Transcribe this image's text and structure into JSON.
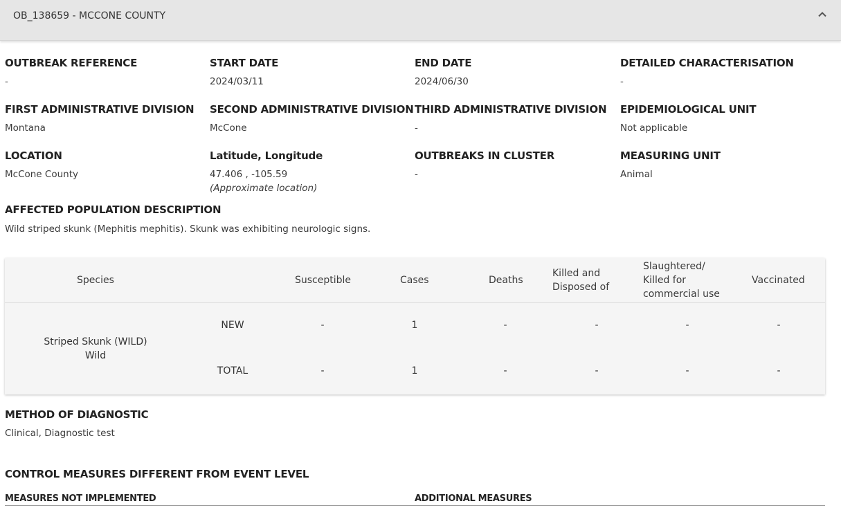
{
  "header": {
    "title": "OB_138659 - MCCONE COUNTY"
  },
  "fields": {
    "outbreak_reference": {
      "label": "OUTBREAK REFERENCE",
      "value": "-"
    },
    "start_date": {
      "label": "START DATE",
      "value": "2024/03/11"
    },
    "end_date": {
      "label": "END DATE",
      "value": "2024/06/30"
    },
    "detailed_characterisation": {
      "label": "DETAILED CHARACTERISATION",
      "value": "-"
    },
    "first_admin_division": {
      "label": "FIRST ADMINISTRATIVE DIVISION",
      "value": "Montana"
    },
    "second_admin_division": {
      "label": "SECOND ADMINISTRATIVE DIVISION",
      "value": "McCone"
    },
    "third_admin_division": {
      "label": "THIRD ADMINISTRATIVE DIVISION",
      "value": "-"
    },
    "epidemiological_unit": {
      "label": "EPIDEMIOLOGICAL UNIT",
      "value": "Not applicable"
    },
    "location": {
      "label": "LOCATION",
      "value": "McCone County"
    },
    "lat_long": {
      "label": "Latitude, Longitude",
      "value": "47.406 , -105.59",
      "note": "(Approximate location)"
    },
    "outbreaks_in_cluster": {
      "label": "OUTBREAKS IN CLUSTER",
      "value": "-"
    },
    "measuring_unit": {
      "label": "MEASURING UNIT",
      "value": "Animal"
    },
    "affected_population": {
      "label": "AFFECTED POPULATION DESCRIPTION",
      "value": "Wild striped skunk (Mephitis mephitis). Skunk was exhibiting neurologic signs."
    }
  },
  "table": {
    "headers": {
      "species": "Species",
      "susceptible": "Susceptible",
      "cases": "Cases",
      "deaths": "Deaths",
      "killed_line1": "Killed and",
      "killed_line2": "Disposed of",
      "slaughtered_line1": "Slaughtered/",
      "slaughtered_line2": "Killed for",
      "slaughtered_line3": "commercial use",
      "vaccinated": "Vaccinated"
    },
    "species_name": "Striped Skunk (WILD)",
    "species_type": "Wild",
    "rows": [
      {
        "label": "NEW",
        "susceptible": "-",
        "cases": "1",
        "deaths": "-",
        "killed": "-",
        "slaughtered": "-",
        "vaccinated": "-"
      },
      {
        "label": "TOTAL",
        "susceptible": "-",
        "cases": "1",
        "deaths": "-",
        "killed": "-",
        "slaughtered": "-",
        "vaccinated": "-"
      }
    ]
  },
  "method_of_diagnostic": {
    "label": "METHOD OF DIAGNOSTIC",
    "value": "Clinical, Diagnostic test"
  },
  "control_measures": {
    "title": "CONTROL MEASURES DIFFERENT FROM EVENT LEVEL",
    "not_implemented_label": "MEASURES NOT IMPLEMENTED",
    "additional_label": "ADDITIONAL MEASURES"
  },
  "icons": {
    "collapse": "chevron-up-icon"
  },
  "colors": {
    "header_bg": "#e6e6e6",
    "table_bg": "#f5f5f5",
    "text": "#333333"
  }
}
